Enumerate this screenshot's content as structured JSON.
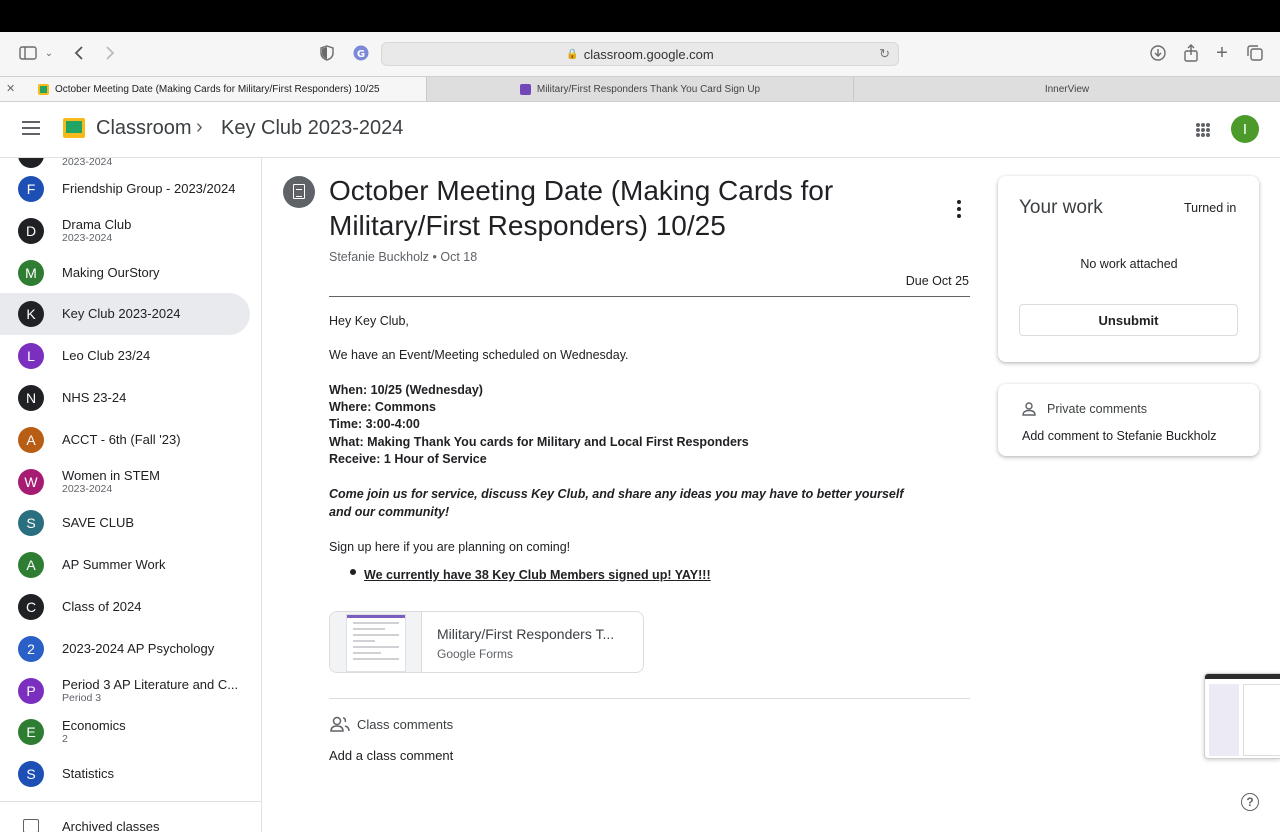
{
  "browser": {
    "url": "classroom.google.com",
    "tabs": [
      {
        "title": "October Meeting Date (Making Cards for Military/First Responders) 10/25",
        "active": true
      },
      {
        "title": "Military/First Responders Thank You Card Sign Up",
        "active": false
      },
      {
        "title": "InnerView",
        "active": false
      }
    ]
  },
  "appbar": {
    "app_name": "Classroom",
    "separator": "›",
    "class_name": "Key Club 2023-2024",
    "avatar_letter": "I"
  },
  "sidebar": {
    "partial_item_sub": "2023-2024",
    "items": [
      {
        "letter": "F",
        "name": "Friendship Group - 2023/2024",
        "sub": "",
        "color": "#1e4fb4"
      },
      {
        "letter": "D",
        "name": "Drama Club",
        "sub": "2023-2024",
        "color": "#202124"
      },
      {
        "letter": "M",
        "name": "Making OurStory",
        "sub": "",
        "color": "#2e7d32"
      },
      {
        "letter": "K",
        "name": "Key Club 2023-2024",
        "sub": "",
        "color": "#202124",
        "selected": true
      },
      {
        "letter": "L",
        "name": "Leo Club 23/24",
        "sub": "",
        "color": "#7b2fbf"
      },
      {
        "letter": "N",
        "name": "NHS 23-24",
        "sub": "",
        "color": "#202124"
      },
      {
        "letter": "A",
        "name": "ACCT - 6th (Fall '23)",
        "sub": "",
        "color": "#b75d14"
      },
      {
        "letter": "W",
        "name": "Women in STEM",
        "sub": "2023-2024",
        "color": "#a61c73"
      },
      {
        "letter": "S",
        "name": "SAVE CLUB",
        "sub": "",
        "color": "#2a6f7f"
      },
      {
        "letter": "A",
        "name": "AP Summer Work",
        "sub": "",
        "color": "#2e7d32"
      },
      {
        "letter": "C",
        "name": "Class of 2024",
        "sub": "",
        "color": "#202124"
      },
      {
        "letter": "2",
        "name": "2023-2024 AP Psychology",
        "sub": "",
        "color": "#2a5fc7"
      },
      {
        "letter": "P",
        "name": "Period 3 AP Literature and C...",
        "sub": "Period 3",
        "color": "#7b2fbf"
      },
      {
        "letter": "E",
        "name": "Economics",
        "sub": "2",
        "color": "#2e7d32"
      },
      {
        "letter": "S",
        "name": "Statistics",
        "sub": "",
        "color": "#1e4fb4"
      }
    ],
    "archived_label": "Archived classes"
  },
  "post": {
    "title": "October Meeting Date (Making Cards for Military/First Responders) 10/25",
    "author": "Stefanie Buckholz",
    "date": "Oct 18",
    "meta_sep": " • ",
    "due": "Due Oct 25",
    "greeting": "Hey Key Club,",
    "intro": "We have an Event/Meeting scheduled on Wednesday.",
    "details": [
      "When:  10/25 (Wednesday)",
      "Where: Commons",
      "Time: 3:00-4:00",
      "What: Making Thank You cards for Military and Local First Responders",
      "Receive: 1 Hour of Service"
    ],
    "call_to_action": "Come join us for service, discuss Key Club, and share any ideas you may have to better yourself and our community!",
    "signup": "Sign up here if you are planning on coming!",
    "bullet": "We currently have 38 Key Club Members signed up!  YAY!!!",
    "attachment": {
      "title": "Military/First Responders T...",
      "type": "Google Forms"
    },
    "class_comments_label": "Class comments",
    "add_class_comment": "Add a class comment"
  },
  "your_work": {
    "title": "Your work",
    "status": "Turned in",
    "empty": "No work attached",
    "button": "Unsubmit"
  },
  "private_comments": {
    "label": "Private comments",
    "add": "Add comment to Stefanie Buckholz"
  },
  "help_glyph": "?",
  "icons": [
    "sidebar-toggle-icon",
    "back-icon",
    "forward-icon",
    "shield-icon",
    "download-icon",
    "share-icon",
    "new-tab-icon",
    "tabs-overview-icon",
    "menu-icon",
    "apps-grid-icon",
    "assignment-icon",
    "more-vert-icon",
    "people-icon",
    "person-icon",
    "archive-icon",
    "help-icon"
  ]
}
